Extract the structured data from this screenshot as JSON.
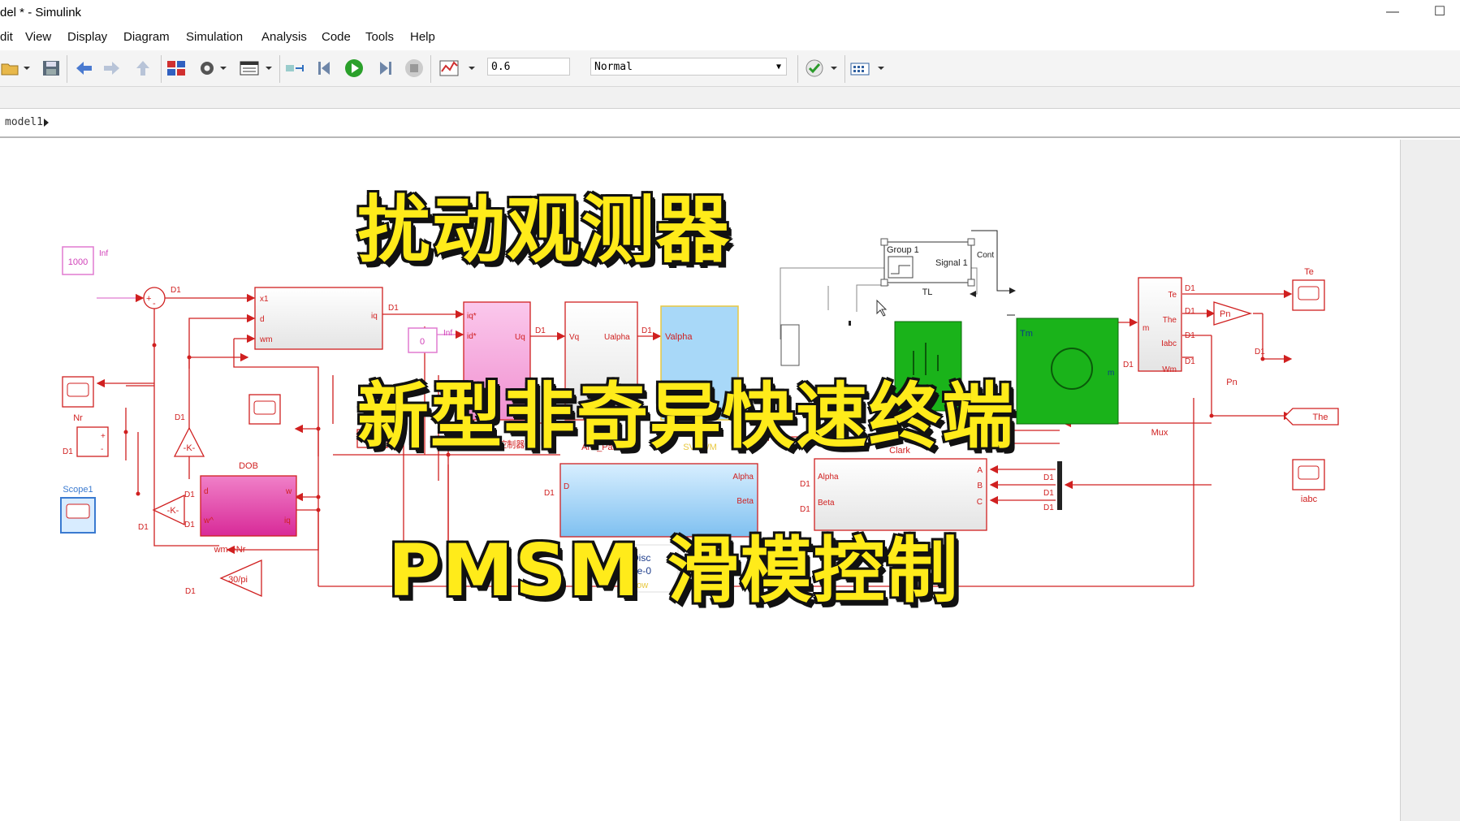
{
  "window": {
    "title": "del * - Simulink",
    "minimize_glyph": "—",
    "restore_glyph": "☐"
  },
  "menu": [
    "dit",
    "View",
    "Display",
    "Diagram",
    "Simulation",
    "Analysis",
    "Code",
    "Tools",
    "Help"
  ],
  "toolbar": {
    "stop_time": "0.6",
    "sim_mode": "Normal",
    "mode_arrow": "▼"
  },
  "breadcrumb": {
    "model": "model1"
  },
  "overlay": {
    "line1": "扰动观测器",
    "line2": "新型非奇异快速终端",
    "line3": "PMSM 滑模控制"
  },
  "diagram": {
    "blocks": {
      "const_1000": "1000",
      "inf_1": "Inf",
      "d1": "D1",
      "sum_plus": "+",
      "sum_minus": "-",
      "ctrl_x1": "x1",
      "ctrl_d": "d",
      "ctrl_wm": "wm",
      "ctrl_iq": "iq",
      "const_0": "0",
      "inf_2": "Inf",
      "dpc_iq": "iq*",
      "dpc_id": "id*",
      "dpc_uq": "Uq",
      "dpc_label": "DPC电流控制器",
      "ap_vq": "Vq",
      "ap_ualpha": "Ualpha",
      "ap_label": "Anti_Park",
      "sv_valpha": "Valpha",
      "sv_label": "SVPWM",
      "group_title": "Group 1",
      "group_signal": "Signal 1",
      "group_cont": "Cont",
      "group_label": "TL",
      "motor_tm": "Tm",
      "motor_m": "m",
      "mux_te": "Te",
      "mux_the": "The",
      "mux_iabc": "Iabc",
      "mux_wm": "Wm",
      "mux_m": "m",
      "mux_label": "Mux",
      "pn": "Pn",
      "pn_label": "Pn",
      "te_label": "Te",
      "the_label": "The",
      "iabc_label": "iabc",
      "nr_label": "Nr",
      "scope1_label": "Scope1",
      "gain_k1": "-K-",
      "gain_k2": "-K-",
      "dob_d": "d",
      "dob_w": "w",
      "dob_wstar": "w^",
      "dob_iq": "iq",
      "dob_label": "DOB",
      "wm_nr_label": "wm->Nr",
      "gain_30pi": "30/pi",
      "park_d": "D",
      "park_alpha": "Alpha",
      "park_beta": "Beta",
      "clark_alpha": "Alpha",
      "clark_beta": "Beta",
      "clark_a": "A",
      "clark_b": "B",
      "clark_c": "C",
      "clark_label": "Clark",
      "powergui_1": "Disc",
      "powergui_2": "1e-0",
      "powergui_3": "pow"
    }
  },
  "colors": {
    "wire": "#d02020",
    "overlay_fill": "#ffeb1a",
    "dpc_fill": "#f9a8e0",
    "svpwm_fill": "#a8d8f8",
    "motor_fill": "#1ab31a",
    "dob_fill": "#e040a8",
    "park_fill": "#9ccff5"
  }
}
